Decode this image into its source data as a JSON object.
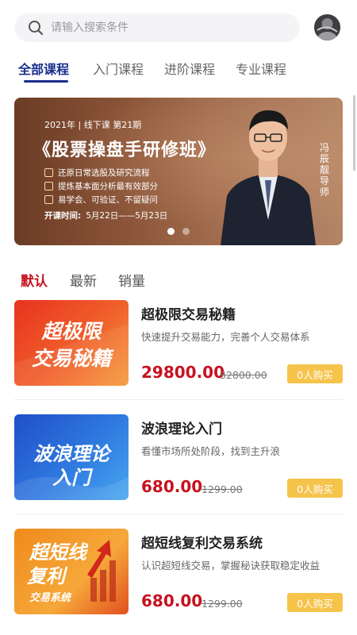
{
  "search": {
    "placeholder": "请输入搜索条件"
  },
  "tabs": [
    {
      "label": "全部课程",
      "active": true
    },
    {
      "label": "入门课程",
      "active": false
    },
    {
      "label": "进阶课程",
      "active": false
    },
    {
      "label": "专业课程",
      "active": false
    }
  ],
  "banner": {
    "edition": "2021年 | 线下课 第21期",
    "title": "《股票操盘手研修班》",
    "features": [
      "还原日常选股及研究流程",
      "提炼基本面分析最有效部分",
      "易学会、可验证、不留疑问"
    ],
    "time_label": "开课时间:",
    "time_value": "5月22日——5月23日",
    "teacher": "冯辰靓导师",
    "slide_count": 2,
    "active_slide": 0
  },
  "sort": [
    {
      "label": "默认",
      "active": true
    },
    {
      "label": "最新",
      "active": false
    },
    {
      "label": "销量",
      "active": false
    }
  ],
  "courses": [
    {
      "thumb_line1": "超极限",
      "thumb_line2": "交易秘籍",
      "title": "超极限交易秘籍",
      "desc": "快速提升交易能力，完善个人交易体系",
      "price": "29800.00",
      "orig_price": "32800.00",
      "buy_label": "0人购买"
    },
    {
      "thumb_line1": "波浪理论",
      "thumb_line2": "入门",
      "title": "波浪理论入门",
      "desc": "看懂市场所处阶段，找到主升浪",
      "price": "680.00",
      "orig_price": "1299.00",
      "buy_label": "0人购买"
    },
    {
      "thumb_line1": "超短线",
      "thumb_line2": "复利",
      "thumb_line3": "交易系统",
      "title": "超短线复利交易系统",
      "desc": "认识超短线交易，掌握秘诀获取稳定收益",
      "price": "680.00",
      "orig_price": "1299.00",
      "buy_label": "0人购买"
    }
  ],
  "colors": {
    "accent_blue": "#1a2f8c",
    "accent_red": "#c6121f",
    "buy_button": "#f6c34b"
  }
}
